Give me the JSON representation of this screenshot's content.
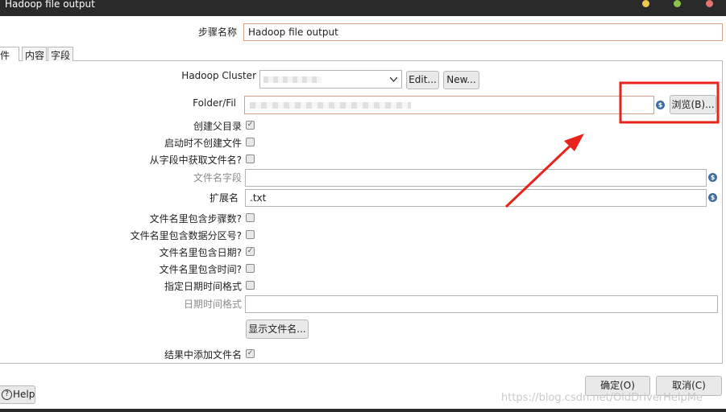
{
  "window": {
    "title": "Hadoop file output",
    "controls": {
      "min_color": "#f0c94a",
      "max_color": "#8bc34a",
      "close_color": "#e57373"
    }
  },
  "step_name": {
    "label": "步骤名称",
    "value": "Hadoop file output"
  },
  "tabs": [
    "件",
    "内容",
    "字段"
  ],
  "form": {
    "hadoop_cluster_label": "Hadoop Cluster",
    "edit_button": "Edit...",
    "new_button": "New...",
    "folder_label": "Folder/Fil",
    "browse_button": "浏览(B)...",
    "create_parent_label": "创建父目录",
    "create_parent_checked": true,
    "no_create_label": "启动时不创建文件",
    "no_create_checked": false,
    "from_field_label": "从字段中获取文件名?",
    "from_field_checked": false,
    "filename_field_label": "文件名字段",
    "extension_label": "扩展名",
    "extension_value": ".txt",
    "include_stepnr_label": "文件名里包含步骤数?",
    "include_stepnr_checked": false,
    "include_partnr_label": "文件名里包含数据分区号?",
    "include_partnr_checked": false,
    "include_date_label": "文件名里包含日期?",
    "include_date_checked": true,
    "include_time_label": "文件名里包含时间?",
    "include_time_checked": false,
    "specify_format_label": "指定日期时间格式",
    "specify_format_checked": false,
    "datetime_format_label": "日期时间格式",
    "show_filenames_button": "显示文件名...",
    "add_to_result_label": "结果中添加文件名",
    "add_to_result_checked": true
  },
  "footer": {
    "help_button": "Help",
    "ok_button": "确定(O)",
    "cancel_button": "取消(C)",
    "watermark": "https://blog.csdn.net/OldDriverHelpMe"
  },
  "annotation": {
    "color": "#e8231b"
  }
}
